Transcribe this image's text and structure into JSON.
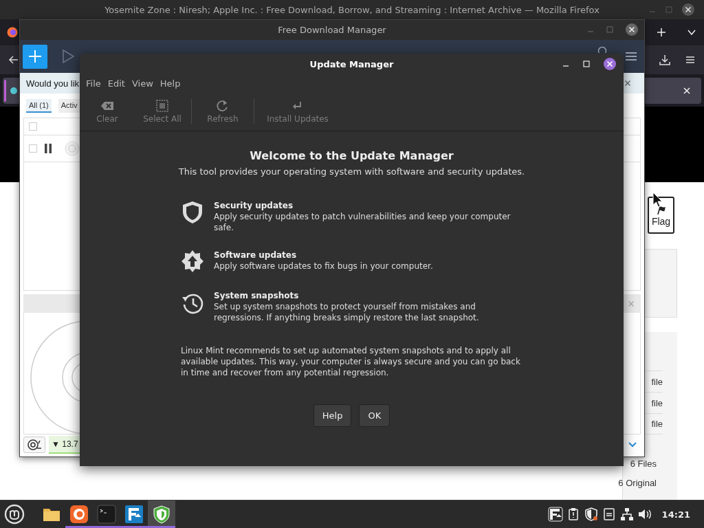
{
  "firefox": {
    "title": "Yosemite Zone : Niresh; Apple Inc. : Free Download, Borrow, and Streaming : Internet Archive — Mozilla Firefox",
    "page": {
      "flag_button": "Flag",
      "file_rows": [
        "file",
        "file",
        "file"
      ],
      "counts": [
        "6 Files",
        "6 Original"
      ]
    }
  },
  "download_manager": {
    "title": "Free Download Manager",
    "notice": "Would you lik",
    "tabs": [
      {
        "label": "All (1)",
        "selected": true
      },
      {
        "label": "Activ",
        "selected": false
      }
    ],
    "header_checked": false,
    "downloads": [
      {
        "checked": false
      }
    ],
    "speed": "▼ 13.7"
  },
  "update_manager": {
    "title": "Update Manager",
    "menu": [
      "File",
      "Edit",
      "View",
      "Help"
    ],
    "toolbar": [
      {
        "kind": "clear",
        "label": "Clear",
        "disabled": true
      },
      {
        "kind": "select-all",
        "label": "Select All",
        "disabled": true
      },
      {
        "kind": "refresh",
        "label": "Refresh",
        "disabled": true
      },
      {
        "kind": "install",
        "label": "Install Updates",
        "disabled": true
      }
    ],
    "heading": "Welcome to the Update Manager",
    "intro": "This tool provides your operating system with software and security updates.",
    "features": [
      {
        "kind": "security",
        "title": "Security updates",
        "text": "Apply security updates to patch vulnerabilities and keep your computer safe."
      },
      {
        "kind": "software",
        "title": "Software updates",
        "text": "Apply software updates to fix bugs in your computer."
      },
      {
        "kind": "snapshots",
        "title": "System snapshots",
        "text": "Set up system snapshots to protect yourself from mistakes and regressions. If anything breaks simply restore the last snapshot."
      }
    ],
    "note": "Linux Mint recommends to set up automated system snapshots and to apply all available updates. This way, your computer is always secure and you can go back in time and recover from any potential regression.",
    "buttons": [
      "Help",
      "OK"
    ]
  },
  "taskbar": {
    "apps": [
      {
        "kind": "files",
        "running": false,
        "selected": false
      },
      {
        "kind": "browser",
        "running": true,
        "selected": false
      },
      {
        "kind": "terminal",
        "running": true,
        "selected": false
      },
      {
        "kind": "download-manager",
        "running": true,
        "selected": false
      },
      {
        "kind": "update-manager",
        "running": true,
        "selected": true
      }
    ],
    "tray": [
      {
        "kind": "download-manager"
      },
      {
        "kind": "clipboard"
      },
      {
        "kind": "shield"
      },
      {
        "kind": "notes"
      },
      {
        "kind": "network"
      },
      {
        "kind": "volume"
      }
    ],
    "clock": "14:21"
  }
}
